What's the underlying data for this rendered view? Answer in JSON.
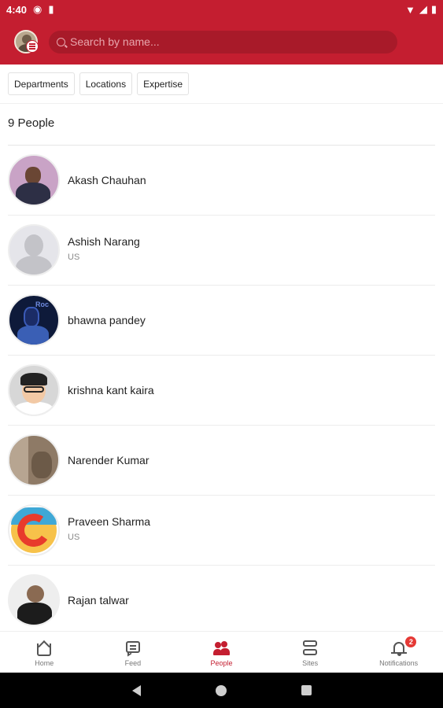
{
  "status_bar": {
    "time": "4:40",
    "left_icons": [
      "p-notification-icon",
      "sd-card-icon"
    ],
    "right_icons": [
      "wifi-icon",
      "signal-icon",
      "battery-icon"
    ]
  },
  "header": {
    "search_placeholder": "Search by name...",
    "accent_color": "#c41e30"
  },
  "filters": [
    "Departments",
    "Locations",
    "Expertise"
  ],
  "people_count_label": "9 People",
  "people": [
    {
      "name": "Akash Chauhan",
      "location": ""
    },
    {
      "name": "Ashish Narang",
      "location": "US"
    },
    {
      "name": "bhawna pandey",
      "location": "",
      "avatar_text": "Roc"
    },
    {
      "name": "krishna kant kaira",
      "location": ""
    },
    {
      "name": "Narender Kumar",
      "location": ""
    },
    {
      "name": "Praveen Sharma",
      "location": "US"
    },
    {
      "name": "Rajan talwar",
      "location": ""
    }
  ],
  "bottom_nav": [
    {
      "label": "Home",
      "icon": "home-icon",
      "active": false
    },
    {
      "label": "Feed",
      "icon": "feed-icon",
      "active": false
    },
    {
      "label": "People",
      "icon": "people-icon",
      "active": true
    },
    {
      "label": "Sites",
      "icon": "sites-icon",
      "active": false
    },
    {
      "label": "Notifications",
      "icon": "bell-icon",
      "active": false,
      "badge": "2"
    }
  ],
  "system_nav": [
    "back-icon",
    "home-circle-icon",
    "recents-icon"
  ]
}
